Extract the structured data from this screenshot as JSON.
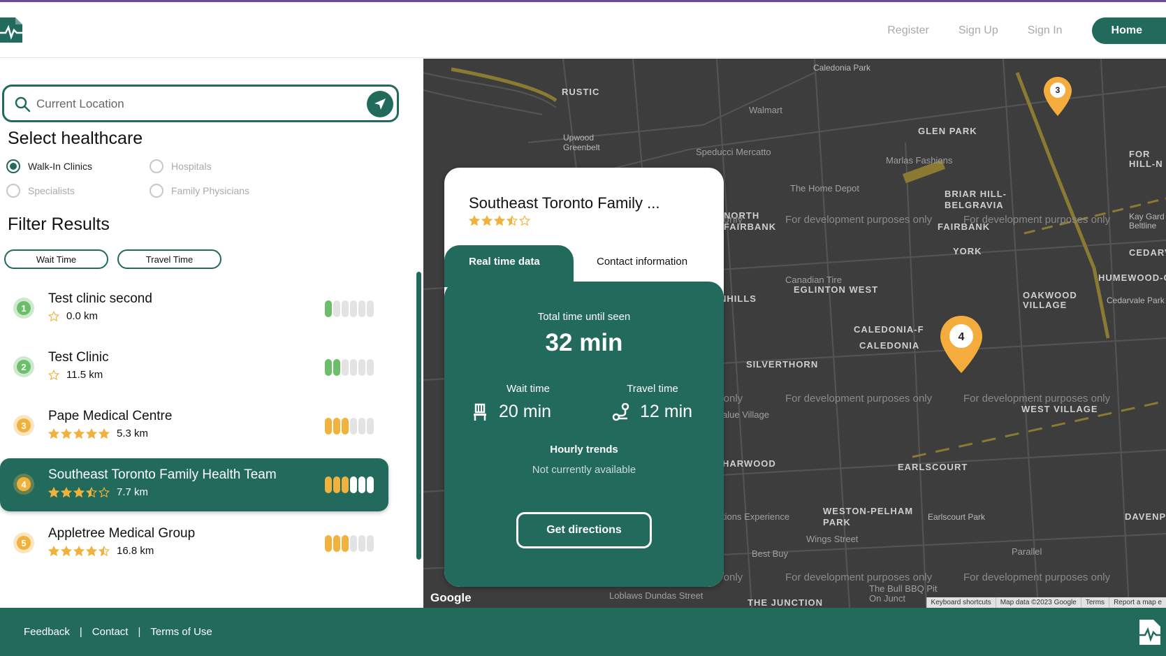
{
  "header": {
    "logo_icon": "heartbeat-document-icon",
    "nav": {
      "register": "Register",
      "signup": "Sign Up",
      "signin": "Sign In",
      "home": "Home"
    }
  },
  "search": {
    "placeholder": "Current Location",
    "value": ""
  },
  "healthcare": {
    "title": "Select healthcare",
    "options": [
      {
        "label": "Walk-In Clinics",
        "selected": true
      },
      {
        "label": "Hospitals",
        "selected": false
      },
      {
        "label": "Specialists",
        "selected": false
      },
      {
        "label": "Family Physicians",
        "selected": false
      }
    ]
  },
  "filter": {
    "title": "Filter Results",
    "wait_time": "Wait Time",
    "travel_time": "Travel Time"
  },
  "results": [
    {
      "num": "1",
      "name": "Test clinic second",
      "distance": "0.0 km",
      "rating": 0,
      "busy_level": 1,
      "color": "#6bbf6b"
    },
    {
      "num": "2",
      "name": "Test Clinic",
      "distance": "11.5 km",
      "rating": 0,
      "busy_level": 2,
      "color": "#6bbf6b"
    },
    {
      "num": "3",
      "name": "Pape Medical Centre",
      "distance": "5.3 km",
      "rating": 5,
      "busy_level": 3,
      "color": "#f0b23c"
    },
    {
      "num": "4",
      "name": "Southeast Toronto Family Health Team",
      "distance": "7.7 km",
      "rating": 3.5,
      "busy_level": 3,
      "color": "#f0b23c",
      "active": true
    },
    {
      "num": "5",
      "name": "Appletree Medical Group",
      "distance": "16.8 km",
      "rating": 4.5,
      "busy_level": 3,
      "color": "#f0b23c"
    }
  ],
  "map": {
    "labels": [
      "RUSTIC",
      "Caledonia Park",
      "Upwood Greenbelt",
      "GLEN PARK",
      "BRIAR HILL-BELGRAVIA",
      "NORTH FAIRBANK",
      "FAIRBANK",
      "YORK",
      "EGLINTON WEST",
      "CALEDONIA-F",
      "CALEDONIA",
      "SILVERTHORN",
      "OAKWOOD VILLAGE",
      "Cedarvale Park",
      "HUMEWOOD-CE",
      "CEDARVALE",
      "WEST VILLAGE",
      "HARWOOD",
      "EARLSCOURT",
      "WESTON-PELHAM PARK",
      "Earlscourt Park",
      "DAVENP",
      "THE JUNCTION",
      "FOR HILL-N",
      "NHILLS",
      "Kay Gard Beltline"
    ],
    "pois": [
      "Walmart",
      "Speducci Mercatto",
      "Marlas Fashions",
      "The Home Depot",
      "Canadian Tire",
      "alue Village",
      "tions Experience",
      "Wings Street",
      "Best Buy",
      "Parallel",
      "Loblaws Dundas Street",
      "The Bull BBQ Pit On Junct"
    ],
    "dev_text": "For development purposes only",
    "dev_text_partial": "s only",
    "google": "Google",
    "footer": [
      "Keyboard shortcuts",
      "Map data ©2023 Google",
      "Terms",
      "Report a map e"
    ],
    "pin_labels": [
      "3",
      "4"
    ],
    "pin_color": "#f4ad3d"
  },
  "card": {
    "title": "Southeast Toronto Family ...",
    "rating": 3.5,
    "tab_active": "Real time data",
    "tab_other": "Contact information",
    "total_label": "Total time until seen",
    "total_value": "32 min",
    "wait_label": "Wait time",
    "wait_value": "20 min",
    "travel_label": "Travel time",
    "travel_value": "12 min",
    "hourly_label": "Hourly trends",
    "hourly_value": "Not currently available",
    "directions": "Get directions"
  },
  "footer": {
    "feedback": "Feedback",
    "contact": "Contact",
    "terms": "Terms of Use",
    "sep": "|"
  },
  "colors": {
    "primary": "#226a5c",
    "accent": "#f0b23c",
    "green": "#6bbf6b"
  }
}
